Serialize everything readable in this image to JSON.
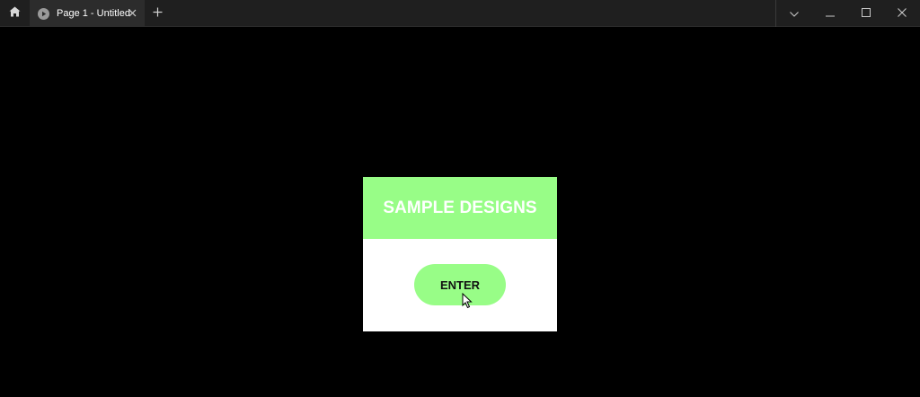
{
  "titlebar": {
    "tab_label": "Page 1 - Untitled",
    "icons": [
      "home-icon",
      "play-icon",
      "close-icon",
      "plus-icon",
      "chevron-down-icon",
      "minimize-icon",
      "maximize-icon",
      "close-icon"
    ]
  },
  "card": {
    "title": "SAMPLE DESIGNS",
    "button_label": "ENTER"
  },
  "colors": {
    "accent": "#98fd87",
    "background": "#000000",
    "card": "#ffffff",
    "titlebar": "#1f1f1f",
    "tab": "#2c2c2c"
  }
}
